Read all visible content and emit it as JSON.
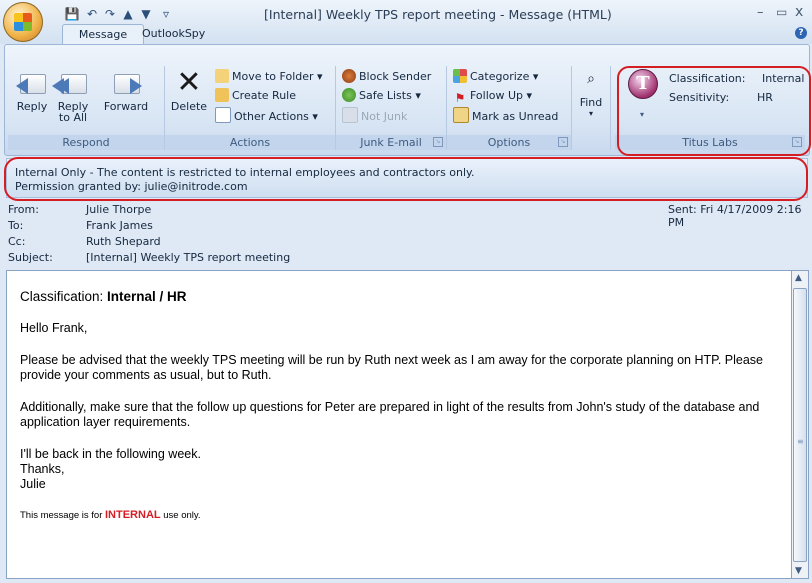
{
  "window": {
    "title": "[Internal] Weekly TPS report meeting - Message (HTML)",
    "minimize": "–",
    "maximize": "▭",
    "close": "x"
  },
  "quick_access": {
    "save": "💾",
    "undo": "↶",
    "redo": "↷",
    "up": "▲",
    "down": "▼",
    "more": "▿"
  },
  "tabs": [
    {
      "label": "Message"
    },
    {
      "label": "OutlookSpy"
    }
  ],
  "help": "?",
  "ribbon": {
    "respond": {
      "label": "Respond",
      "reply": "Reply",
      "reply_all_1": "Reply",
      "reply_all_2": "to All",
      "forward": "Forward"
    },
    "actions": {
      "label": "Actions",
      "delete": "Delete",
      "move_to_folder": "Move to Folder ▾",
      "create_rule": "Create Rule",
      "other_actions": "Other Actions ▾"
    },
    "junk": {
      "label": "Junk E-mail",
      "block_sender": "Block Sender",
      "safe_lists": "Safe Lists ▾",
      "not_junk": "Not Junk"
    },
    "options": {
      "label": "Options",
      "categorize": "Categorize ▾",
      "follow_up": "Follow Up ▾",
      "mark_unread": "Mark as Unread"
    },
    "find": {
      "label": "Find"
    },
    "titus": {
      "label": "Titus Labs",
      "classification_label": "Classification:",
      "classification_value": "Internal",
      "sensitivity_label": "Sensitivity:",
      "sensitivity_value": "HR",
      "dropdown": "▾"
    }
  },
  "infobar": {
    "line1": "Internal Only - The content is restricted to internal employees and contractors only.",
    "line2": "Permission granted by: julie@initrode.com"
  },
  "header": {
    "from_label": "From:",
    "from_value": "Julie Thorpe",
    "to_label": "To:",
    "to_value": "Frank James",
    "cc_label": "Cc:",
    "cc_value": "Ruth Shepard",
    "subject_label": "Subject:",
    "subject_value": "[Internal] Weekly TPS report meeting",
    "sent_label": "Sent:",
    "sent_value": "Fri 4/17/2009 2:16 PM"
  },
  "body": {
    "classification_prefix": "Classification: ",
    "classification_value": "Internal / HR",
    "greeting": "Hello Frank,",
    "para1": "Please be advised that the weekly TPS meeting will be run by Ruth next week as I am away for the corporate planning on HTP. Please provide your comments as usual, but to Ruth.",
    "para2": "Additionally, make sure that the follow up questions for Peter are prepared in light of the results from John's study of the database and application layer requirements.",
    "closing1": "I'll be back in the following week.",
    "closing2": "Thanks,",
    "signature": "Julie",
    "footer_prefix": "This message is for ",
    "footer_emphasis": "INTERNAL",
    "footer_suffix": " use only."
  },
  "colors": {
    "accent_red": "#d51d24",
    "ribbon_blue": "#c2d5ec"
  }
}
